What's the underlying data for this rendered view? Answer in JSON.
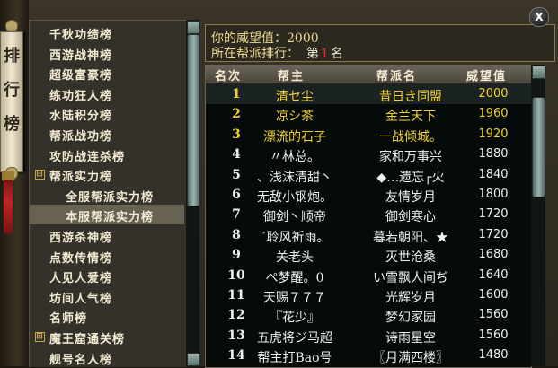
{
  "window": {
    "close_label": "X",
    "scroll_text": "排 行 榜"
  },
  "left_menu": {
    "items": [
      {
        "label": "千秋功绩榜",
        "indent": 0,
        "expander": ""
      },
      {
        "label": "西游战神榜",
        "indent": 0,
        "expander": ""
      },
      {
        "label": "超级富豪榜",
        "indent": 0,
        "expander": ""
      },
      {
        "label": "练功狂人榜",
        "indent": 0,
        "expander": ""
      },
      {
        "label": "水陆积分榜",
        "indent": 0,
        "expander": ""
      },
      {
        "label": "帮派战功榜",
        "indent": 0,
        "expander": ""
      },
      {
        "label": "攻防战连杀榜",
        "indent": 0,
        "expander": ""
      },
      {
        "label": "帮派实力榜",
        "indent": 0,
        "expander": "⊟"
      },
      {
        "label": "全服帮派实力榜",
        "indent": 1,
        "expander": ""
      },
      {
        "label": "本服帮派实力榜",
        "indent": 1,
        "expander": "",
        "selected": true
      },
      {
        "label": "西游杀神榜",
        "indent": 0,
        "expander": ""
      },
      {
        "label": "点数传情榜",
        "indent": 0,
        "expander": ""
      },
      {
        "label": "人见人爱榜",
        "indent": 0,
        "expander": ""
      },
      {
        "label": "坊间人气榜",
        "indent": 0,
        "expander": ""
      },
      {
        "label": "名师榜",
        "indent": 0,
        "expander": ""
      },
      {
        "label": "魔王窟通关榜",
        "indent": 0,
        "expander": "⊞"
      },
      {
        "label": "舰号名人榜",
        "indent": 0,
        "expander": ""
      }
    ]
  },
  "info": {
    "prestige_label": "你的威望值：",
    "prestige_value": "2000",
    "rank_label": "所在帮派排行：",
    "rank_prefix": "第",
    "rank_value": "1",
    "rank_suffix": "名"
  },
  "table": {
    "headers": {
      "rank": "名次",
      "leader": "帮主",
      "guild": "帮派名",
      "score": "威望值"
    },
    "rows": [
      {
        "rank": "1",
        "leader": "清セ尘",
        "guild": "昔日き同盟",
        "score": "2000",
        "style": "gold"
      },
      {
        "rank": "2",
        "leader": "凉シ茶",
        "guild": "金兰天下",
        "score": "1960",
        "style": "gold"
      },
      {
        "rank": "3",
        "leader": "漂流的石子",
        "guild": "一战倾城。",
        "score": "1920",
        "style": "gold"
      },
      {
        "rank": "4",
        "leader": "〃林总。",
        "guild": "家和万事兴",
        "score": "1880",
        "style": "white"
      },
      {
        "rank": "5",
        "leader": "、浅沫清甜丶",
        "guild": "◆…遗忘┌火",
        "score": "1840",
        "style": "white"
      },
      {
        "rank": "6",
        "leader": "无敌小钢炮。",
        "guild": "友情岁月",
        "score": "1800",
        "style": "white"
      },
      {
        "rank": "7",
        "leader": "御剑丶顺帝",
        "guild": "御剑寒心",
        "score": "1720",
        "style": "white"
      },
      {
        "rank": "8",
        "leader": "ˊ聆风祈雨。",
        "guild": "暮若朝阳、★",
        "score": "1720",
        "style": "white"
      },
      {
        "rank": "9",
        "leader": "关老头",
        "guild": "灭世沧桑",
        "score": "1680",
        "style": "white"
      },
      {
        "rank": "10",
        "leader": "ぺ梦醒。0",
        "guild": "い雪飘人间ぢ",
        "score": "1640",
        "style": "white"
      },
      {
        "rank": "11",
        "leader": "天赐７７７",
        "guild": "光辉岁月",
        "score": "1600",
        "style": "white"
      },
      {
        "rank": "12",
        "leader": "『花少』",
        "guild": "梦幻家园",
        "score": "1560",
        "style": "white"
      },
      {
        "rank": "13",
        "leader": "五虎将ジ马超",
        "guild": "诗雨星空",
        "score": "1560",
        "style": "white"
      },
      {
        "rank": "14",
        "leader": "帮主打Bao号",
        "guild": "〖月满西楼〗",
        "score": "1480",
        "style": "white"
      }
    ]
  },
  "colors": {
    "gold": "#f3d030",
    "white": "#f0f0ec",
    "info": "#ecd88f"
  }
}
